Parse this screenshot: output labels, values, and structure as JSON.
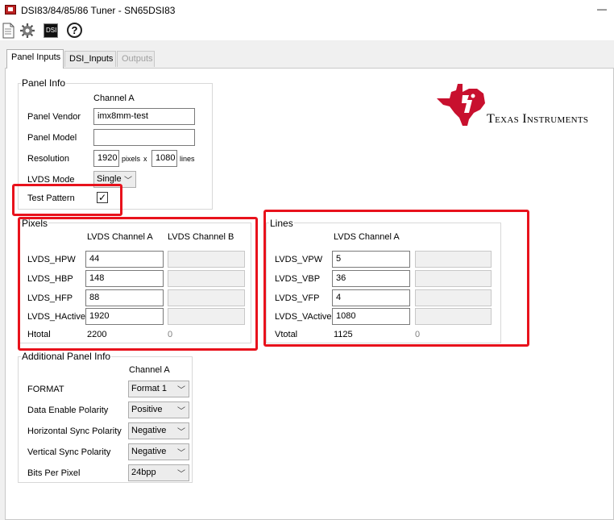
{
  "window": {
    "title": "DSI83/84/85/86 Tuner - SN65DSI83",
    "minimize": "—"
  },
  "toolbar": {
    "buttons": [
      {
        "name": "file-icon"
      },
      {
        "name": "gear-icon"
      },
      {
        "name": "dsi-icon",
        "label": "DSI"
      },
      {
        "name": "help-icon",
        "label": "?"
      }
    ]
  },
  "tabs": [
    {
      "label": "Panel Inputs",
      "state": "active"
    },
    {
      "label": "DSI_Inputs",
      "state": "normal"
    },
    {
      "label": "Outputs",
      "state": "disabled"
    }
  ],
  "logo": {
    "text": "Texas Instruments",
    "color": "#c8102e"
  },
  "panel_info": {
    "title": "Panel Info",
    "channel_header": "Channel A",
    "vendor_label": "Panel Vendor",
    "vendor_value": "imx8mm-test",
    "model_label": "Panel Model",
    "model_value": "",
    "resolution_label": "Resolution",
    "res_w": "1920",
    "pixels_unit": "pixels",
    "x_sep": "x",
    "res_h": "1080",
    "lines_unit": "lines",
    "lvds_mode_label": "LVDS Mode",
    "lvds_mode_value": "Single",
    "test_pattern_label": "Test Pattern",
    "test_pattern_checked": true,
    "check_mark": "✓"
  },
  "pixels": {
    "title": "Pixels",
    "col_a": "LVDS Channel A",
    "col_b": "LVDS Channel B",
    "rows": [
      {
        "label": "LVDS_HPW",
        "a": "44",
        "b": ""
      },
      {
        "label": "LVDS_HBP",
        "a": "148",
        "b": ""
      },
      {
        "label": "LVDS_HFP",
        "a": "88",
        "b": ""
      },
      {
        "label": "LVDS_HActive",
        "a": "1920",
        "b": ""
      }
    ],
    "total_label": "Htotal",
    "total_a": "2200",
    "total_b": "0"
  },
  "lines": {
    "title": "Lines",
    "col_a": "LVDS Channel A",
    "rows": [
      {
        "label": "LVDS_VPW",
        "a": "5",
        "b": ""
      },
      {
        "label": "LVDS_VBP",
        "a": "36",
        "b": ""
      },
      {
        "label": "LVDS_VFP",
        "a": "4",
        "b": ""
      },
      {
        "label": "LVDS_VActive",
        "a": "1080",
        "b": ""
      }
    ],
    "total_label": "Vtotal",
    "total_a": "1125",
    "total_b": "0"
  },
  "additional": {
    "title": "Additional Panel Info",
    "channel_header": "Channel A",
    "rows": [
      {
        "label": "FORMAT",
        "value": "Format 1"
      },
      {
        "label": "Data Enable Polarity",
        "value": "Positive"
      },
      {
        "label": "Horizontal Sync Polarity",
        "value": "Negative"
      },
      {
        "label": "Vertical Sync Polarity",
        "value": "Negative"
      },
      {
        "label": "Bits Per Pixel",
        "value": "24bpp"
      }
    ]
  },
  "highlight_color": "#e8121c",
  "chevron": "﹀"
}
